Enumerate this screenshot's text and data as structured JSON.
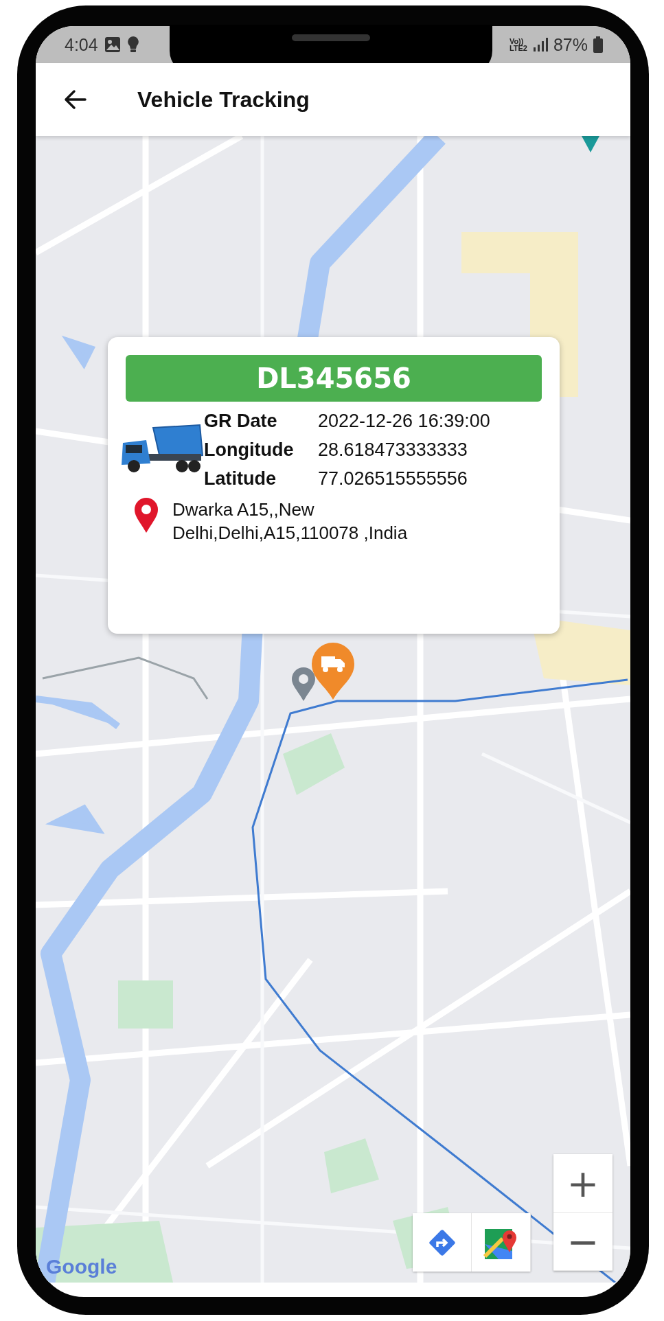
{
  "status_bar": {
    "time": "4:04",
    "volte": "Vo))",
    "network": "LTE2",
    "battery": "87%"
  },
  "app_bar": {
    "title": "Vehicle Tracking"
  },
  "popup": {
    "vehicle_number": "DL345656",
    "fields": [
      {
        "label": "GR Date",
        "value": "2022-12-26 16:39:00"
      },
      {
        "label": "Longitude",
        "value": "28.618473333333"
      },
      {
        "label": "Latitude",
        "value": "77.026515555556"
      }
    ],
    "address": "Dwarka A15,,New Delhi,Delhi,A15,110078 ,India"
  },
  "map": {
    "attribution": "Google",
    "zoom_in": "+",
    "zoom_out": "−"
  }
}
